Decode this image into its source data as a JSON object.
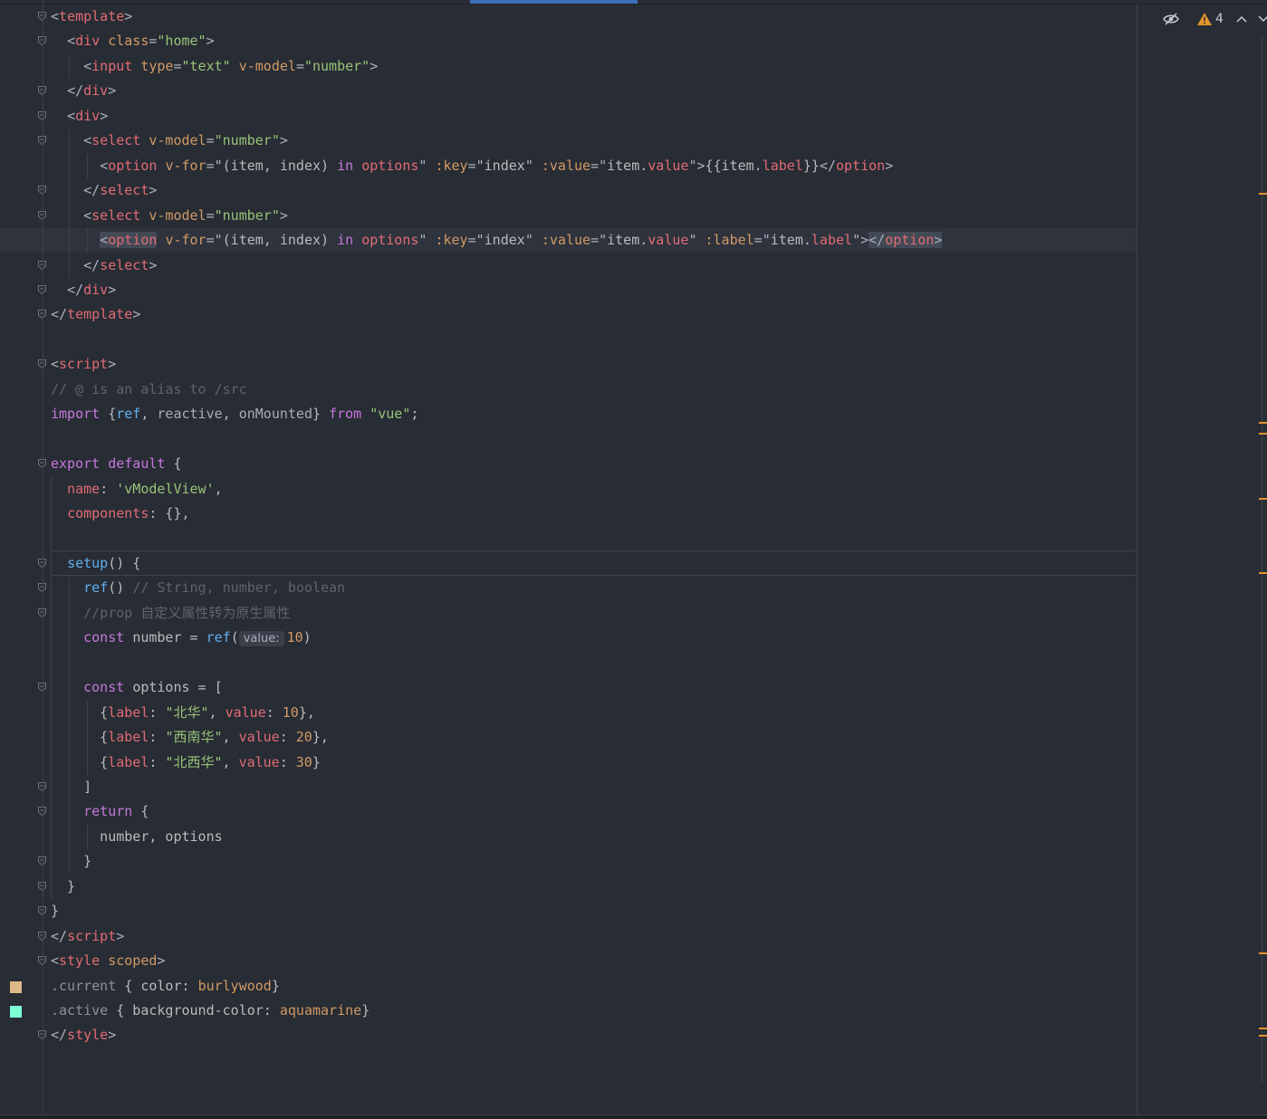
{
  "editor": {
    "lines": [
      {
        "n": 1,
        "tokens": [
          [
            "t-punct",
            "<"
          ],
          [
            "t-tag",
            "template"
          ],
          [
            "t-punct",
            ">"
          ]
        ]
      },
      {
        "n": 2,
        "tokens": [
          [
            "t-plain",
            "  "
          ],
          [
            "t-punct",
            "<"
          ],
          [
            "t-tag",
            "div "
          ],
          [
            "t-attr",
            "class"
          ],
          [
            "t-punct",
            "="
          ],
          [
            "t-str",
            "\"home\""
          ],
          [
            "t-punct",
            ">"
          ]
        ]
      },
      {
        "n": 3,
        "tokens": [
          [
            "t-plain",
            "    "
          ],
          [
            "t-punct",
            "<"
          ],
          [
            "t-tag",
            "input "
          ],
          [
            "t-attr",
            "type"
          ],
          [
            "t-punct",
            "="
          ],
          [
            "t-str",
            "\"text\" "
          ],
          [
            "t-attr",
            "v-model"
          ],
          [
            "t-punct",
            "="
          ],
          [
            "t-str",
            "\"number\""
          ],
          [
            "t-punct",
            ">"
          ]
        ]
      },
      {
        "n": 4,
        "tokens": [
          [
            "t-plain",
            "  "
          ],
          [
            "t-punct",
            "</"
          ],
          [
            "t-tag",
            "div"
          ],
          [
            "t-punct",
            ">"
          ]
        ]
      },
      {
        "n": 5,
        "tokens": [
          [
            "t-plain",
            "  "
          ],
          [
            "t-punct",
            "<"
          ],
          [
            "t-tag",
            "div"
          ],
          [
            "t-punct",
            ">"
          ]
        ]
      },
      {
        "n": 6,
        "tokens": [
          [
            "t-plain",
            "    "
          ],
          [
            "t-punct",
            "<"
          ],
          [
            "t-tag",
            "select "
          ],
          [
            "t-attr",
            "v-model"
          ],
          [
            "t-punct",
            "="
          ],
          [
            "t-str",
            "\"number\""
          ],
          [
            "t-punct",
            ">"
          ]
        ]
      },
      {
        "n": 7,
        "tokens": [
          [
            "t-plain",
            "      "
          ],
          [
            "t-punct",
            "<"
          ],
          [
            "t-tag",
            "option "
          ],
          [
            "t-attr",
            "v-for"
          ],
          [
            "t-punct",
            "=\""
          ],
          [
            "t-plain",
            "(item, index) "
          ],
          [
            "t-kw",
            "in "
          ],
          [
            "t-tag",
            "options"
          ],
          [
            "t-punct",
            "\" "
          ],
          [
            "t-attr",
            ":key"
          ],
          [
            "t-punct",
            "=\""
          ],
          [
            "t-plain",
            "index"
          ],
          [
            "t-punct",
            "\" "
          ],
          [
            "t-attr",
            ":value"
          ],
          [
            "t-punct",
            "=\""
          ],
          [
            "t-plain",
            "item."
          ],
          [
            "t-tag",
            "value"
          ],
          [
            "t-punct",
            "\">"
          ],
          [
            "t-plain",
            "{{item."
          ],
          [
            "t-tag",
            "label"
          ],
          [
            "t-plain",
            "}}"
          ],
          [
            "t-punct",
            "</"
          ],
          [
            "t-tag",
            "option"
          ],
          [
            "t-punct",
            ">"
          ]
        ]
      },
      {
        "n": 8,
        "tokens": [
          [
            "t-plain",
            "    "
          ],
          [
            "t-punct",
            "</"
          ],
          [
            "t-tag",
            "select"
          ],
          [
            "t-punct",
            ">"
          ]
        ]
      },
      {
        "n": 9,
        "tokens": [
          [
            "t-plain",
            "    "
          ],
          [
            "t-punct",
            "<"
          ],
          [
            "t-tag",
            "select "
          ],
          [
            "t-attr",
            "v-model"
          ],
          [
            "t-punct",
            "="
          ],
          [
            "t-str",
            "\"number\""
          ],
          [
            "t-punct",
            ">"
          ]
        ]
      },
      {
        "n": 10,
        "highlighted": true,
        "tokens": [
          [
            "t-plain",
            "      "
          ],
          [
            "t-punct hl-box",
            "<"
          ],
          [
            "t-tag hl-box",
            "option"
          ],
          [
            "t-plain",
            " "
          ],
          [
            "t-attr",
            "v-for"
          ],
          [
            "t-punct",
            "=\""
          ],
          [
            "t-plain",
            "(item, index) "
          ],
          [
            "t-kw",
            "in "
          ],
          [
            "t-tag",
            "options"
          ],
          [
            "t-punct",
            "\" "
          ],
          [
            "t-attr",
            ":key"
          ],
          [
            "t-punct",
            "=\""
          ],
          [
            "t-plain",
            "index"
          ],
          [
            "t-punct",
            "\" "
          ],
          [
            "t-attr",
            ":value"
          ],
          [
            "t-punct",
            "=\""
          ],
          [
            "t-plain",
            "item."
          ],
          [
            "t-tag",
            "value"
          ],
          [
            "t-punct",
            "\" "
          ],
          [
            "t-attr",
            ":label"
          ],
          [
            "t-punct",
            "=\""
          ],
          [
            "t-plain",
            "item."
          ],
          [
            "t-tag",
            "label"
          ],
          [
            "t-punct",
            "\">"
          ],
          [
            "t-punct hl-box",
            "</"
          ],
          [
            "t-tag hl-box",
            "option"
          ],
          [
            "t-punct hl-box",
            ">"
          ]
        ]
      },
      {
        "n": 11,
        "tokens": [
          [
            "t-plain",
            "    "
          ],
          [
            "t-punct",
            "</"
          ],
          [
            "t-tag",
            "select"
          ],
          [
            "t-punct",
            ">"
          ]
        ]
      },
      {
        "n": 12,
        "tokens": [
          [
            "t-plain",
            "  "
          ],
          [
            "t-punct",
            "</"
          ],
          [
            "t-tag",
            "div"
          ],
          [
            "t-punct",
            ">"
          ]
        ]
      },
      {
        "n": 13,
        "tokens": [
          [
            "t-punct",
            "</"
          ],
          [
            "t-tag",
            "template"
          ],
          [
            "t-punct",
            ">"
          ]
        ]
      },
      {
        "n": 14,
        "tokens": []
      },
      {
        "n": 15,
        "tokens": [
          [
            "t-punct",
            "<"
          ],
          [
            "t-tag",
            "script"
          ],
          [
            "t-punct",
            ">"
          ]
        ]
      },
      {
        "n": 16,
        "tokens": [
          [
            "t-comment",
            "// @ is an alias to /src"
          ]
        ]
      },
      {
        "n": 17,
        "tokens": [
          [
            "t-kw",
            "import "
          ],
          [
            "t-plain",
            "{"
          ],
          [
            "t-fn",
            "ref"
          ],
          [
            "t-plain",
            ", "
          ],
          [
            "t-dim",
            "reactive"
          ],
          [
            "t-plain",
            ", "
          ],
          [
            "t-dim",
            "onMounted"
          ],
          [
            "t-plain",
            "} "
          ],
          [
            "t-kw",
            "from "
          ],
          [
            "t-str",
            "\"vue\""
          ],
          [
            "t-plain",
            ";"
          ]
        ]
      },
      {
        "n": 18,
        "tokens": []
      },
      {
        "n": 19,
        "tokens": [
          [
            "t-kw",
            "export default "
          ],
          [
            "t-plain",
            "{"
          ]
        ]
      },
      {
        "n": 20,
        "tokens": [
          [
            "t-plain",
            "  "
          ],
          [
            "t-prop",
            "name"
          ],
          [
            "t-plain",
            ": "
          ],
          [
            "t-str",
            "'vModelView'"
          ],
          [
            "t-plain",
            ","
          ]
        ]
      },
      {
        "n": 21,
        "tokens": [
          [
            "t-plain",
            "  "
          ],
          [
            "t-prop",
            "components"
          ],
          [
            "t-plain",
            ": {},"
          ]
        ]
      },
      {
        "n": 22,
        "tokens": []
      },
      {
        "n": 23,
        "tokens": [
          [
            "t-plain",
            "  "
          ],
          [
            "t-fn",
            "setup"
          ],
          [
            "t-plain",
            "() {"
          ]
        ]
      },
      {
        "n": 24,
        "tokens": [
          [
            "t-plain",
            "    "
          ],
          [
            "t-fn",
            "ref"
          ],
          [
            "t-plain",
            "() "
          ],
          [
            "t-comment",
            "// String, number, boolean"
          ]
        ]
      },
      {
        "n": 25,
        "tokens": [
          [
            "t-plain",
            "    "
          ],
          [
            "t-comment",
            "//prop 自定义属性转为原生属性"
          ]
        ]
      },
      {
        "n": 26,
        "tokens": [
          [
            "t-plain",
            "    "
          ],
          [
            "t-kw",
            "const "
          ],
          [
            "t-plain",
            "number = "
          ],
          [
            "t-fn",
            "ref"
          ],
          [
            "t-plain",
            "("
          ],
          [
            "inlay",
            "value:"
          ],
          [
            "t-num",
            "10"
          ],
          [
            "t-plain",
            ")"
          ]
        ]
      },
      {
        "n": 27,
        "tokens": []
      },
      {
        "n": 28,
        "tokens": [
          [
            "t-plain",
            "    "
          ],
          [
            "t-kw",
            "const "
          ],
          [
            "t-plain",
            "options = ["
          ]
        ]
      },
      {
        "n": 29,
        "tokens": [
          [
            "t-plain",
            "      {"
          ],
          [
            "t-prop",
            "label"
          ],
          [
            "t-plain",
            ": "
          ],
          [
            "t-str",
            "\"北华\""
          ],
          [
            "t-plain",
            ", "
          ],
          [
            "t-prop",
            "value"
          ],
          [
            "t-plain",
            ": "
          ],
          [
            "t-num",
            "10"
          ],
          [
            "t-plain",
            "},"
          ]
        ]
      },
      {
        "n": 30,
        "tokens": [
          [
            "t-plain",
            "      {"
          ],
          [
            "t-prop",
            "label"
          ],
          [
            "t-plain",
            ": "
          ],
          [
            "t-str",
            "\"西南华\""
          ],
          [
            "t-plain",
            ", "
          ],
          [
            "t-prop",
            "value"
          ],
          [
            "t-plain",
            ": "
          ],
          [
            "t-num",
            "20"
          ],
          [
            "t-plain",
            "},"
          ]
        ]
      },
      {
        "n": 31,
        "tokens": [
          [
            "t-plain",
            "      {"
          ],
          [
            "t-prop",
            "label"
          ],
          [
            "t-plain",
            ": "
          ],
          [
            "t-str",
            "\"北西华\""
          ],
          [
            "t-plain",
            ", "
          ],
          [
            "t-prop",
            "value"
          ],
          [
            "t-plain",
            ": "
          ],
          [
            "t-num",
            "30"
          ],
          [
            "t-plain",
            "}"
          ]
        ]
      },
      {
        "n": 32,
        "tokens": [
          [
            "t-plain",
            "    ]"
          ]
        ]
      },
      {
        "n": 33,
        "tokens": [
          [
            "t-plain",
            "    "
          ],
          [
            "t-kw",
            "return "
          ],
          [
            "t-plain",
            "{"
          ]
        ]
      },
      {
        "n": 34,
        "tokens": [
          [
            "t-plain",
            "      number, options"
          ]
        ]
      },
      {
        "n": 35,
        "tokens": [
          [
            "t-plain",
            "    }"
          ]
        ]
      },
      {
        "n": 36,
        "tokens": [
          [
            "t-plain",
            "  }"
          ]
        ]
      },
      {
        "n": 37,
        "tokens": [
          [
            "t-plain",
            "}"
          ]
        ]
      },
      {
        "n": 38,
        "tokens": [
          [
            "t-punct",
            "</"
          ],
          [
            "t-tag",
            "script"
          ],
          [
            "t-punct",
            ">"
          ]
        ]
      },
      {
        "n": 39,
        "tokens": [
          [
            "t-punct",
            "<"
          ],
          [
            "t-tag",
            "style "
          ],
          [
            "t-attr",
            "scoped"
          ],
          [
            "t-punct",
            ">"
          ]
        ]
      },
      {
        "n": 40,
        "tokens": [
          [
            "t-sel",
            ".current "
          ],
          [
            "t-plain",
            "{ color: "
          ],
          [
            "t-num",
            "burlywood"
          ],
          [
            "t-plain",
            "}"
          ]
        ]
      },
      {
        "n": 41,
        "tokens": [
          [
            "t-sel",
            ".active "
          ],
          [
            "t-plain",
            "{ background-color: "
          ],
          [
            "t-num",
            "aquamarine"
          ],
          [
            "t-plain",
            "}"
          ]
        ]
      },
      {
        "n": 42,
        "tokens": [
          [
            "t-punct",
            "</"
          ],
          [
            "t-tag",
            "style"
          ],
          [
            "t-punct",
            ">"
          ]
        ]
      }
    ],
    "fold_lines": [
      1,
      2,
      4,
      5,
      6,
      8,
      9,
      11,
      12,
      13,
      15,
      19,
      23,
      24,
      25,
      28,
      32,
      33,
      35,
      36,
      37,
      38,
      39,
      42
    ],
    "swatches": [
      {
        "line": 40,
        "color": "#deb887"
      },
      {
        "line": 41,
        "color": "#7fffd4"
      }
    ]
  },
  "status": {
    "warning_count": "4",
    "warning_color": "#e3942b"
  }
}
